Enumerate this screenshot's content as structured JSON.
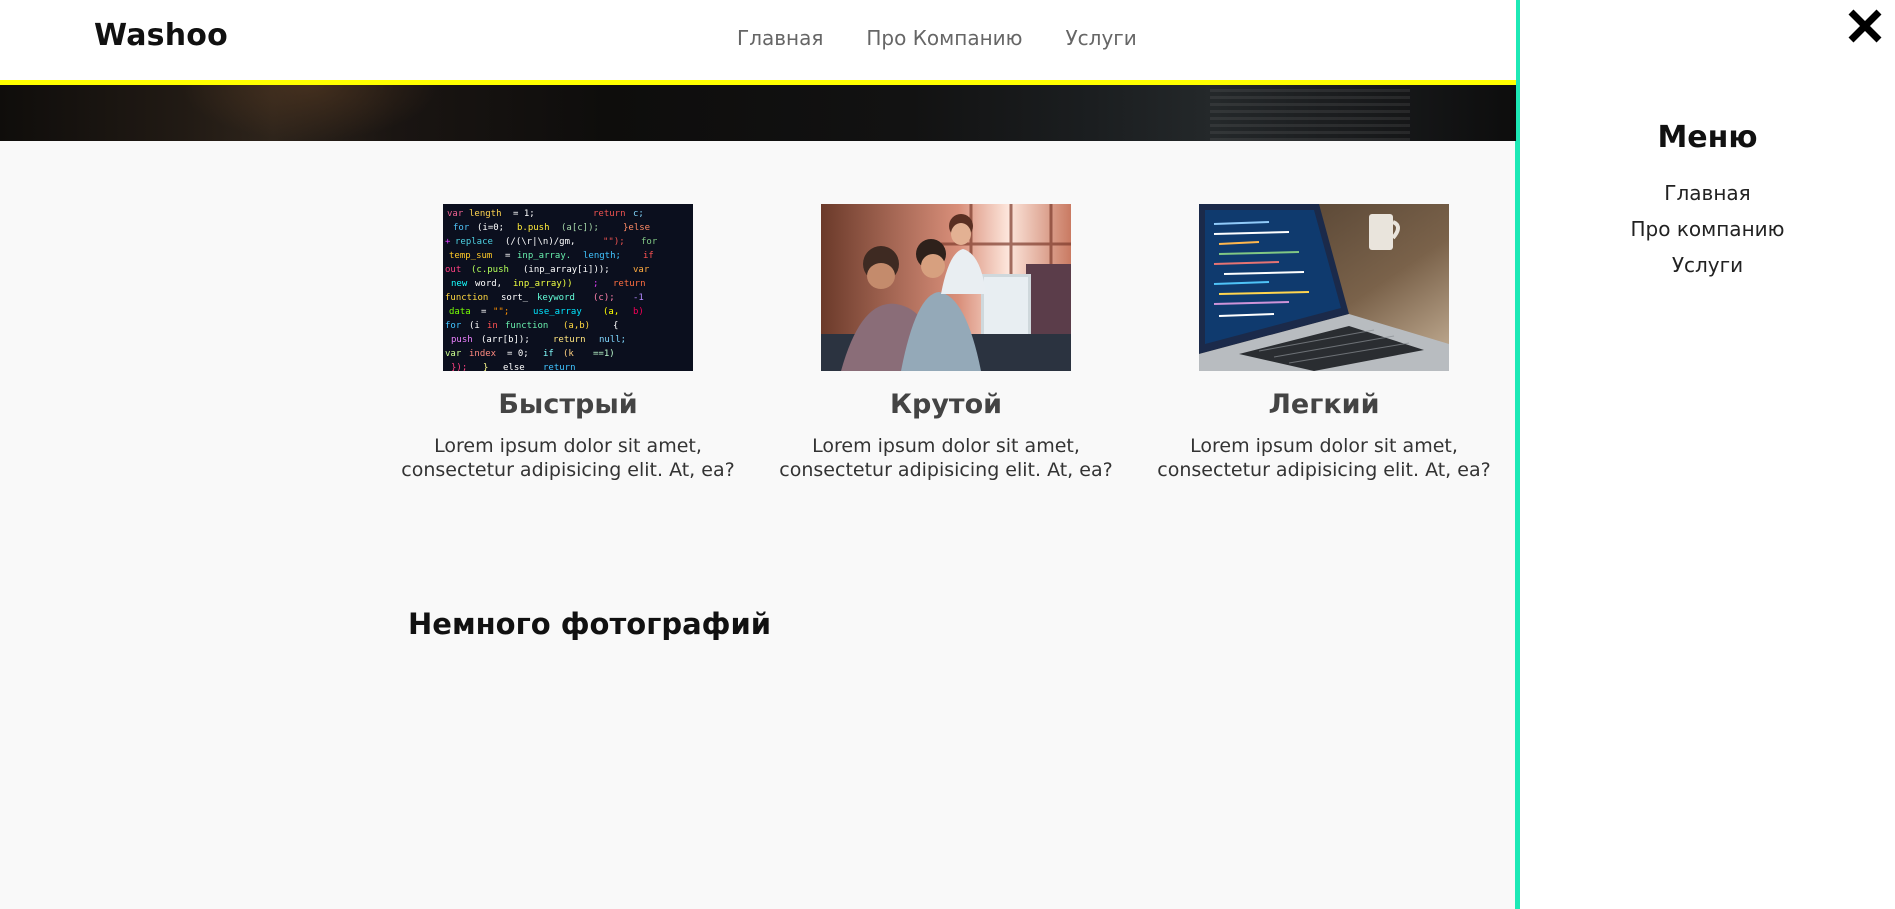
{
  "header": {
    "logo": "Washoo",
    "nav": [
      "Главная",
      "Про Компанию",
      "Услуги"
    ]
  },
  "features": [
    {
      "title": "Быстрый",
      "line1": "Lorem ipsum dolor sit amet,",
      "line2": "consectetur adipisicing elit. At, ea?",
      "image": "code-screen-photo"
    },
    {
      "title": "Крутой",
      "line1": "Lorem ipsum dolor sit amet,",
      "line2": "consectetur adipisicing elit. At, ea?",
      "image": "team-at-computer-photo"
    },
    {
      "title": "Легкий",
      "line1": "Lorem ipsum dolor sit amet,",
      "line2": "consectetur adipisicing elit. At, ea?",
      "image": "laptop-photo"
    }
  ],
  "gallery": {
    "title": "Немного фотографий"
  },
  "sidebar": {
    "title": "Меню",
    "items": [
      "Главная",
      "Про компанию",
      "Услуги"
    ],
    "close_icon": "close-icon"
  },
  "colors": {
    "header_border": "#ffff00",
    "sidebar_divider": "#1de9b6",
    "main_bg": "#f9f9f9"
  }
}
